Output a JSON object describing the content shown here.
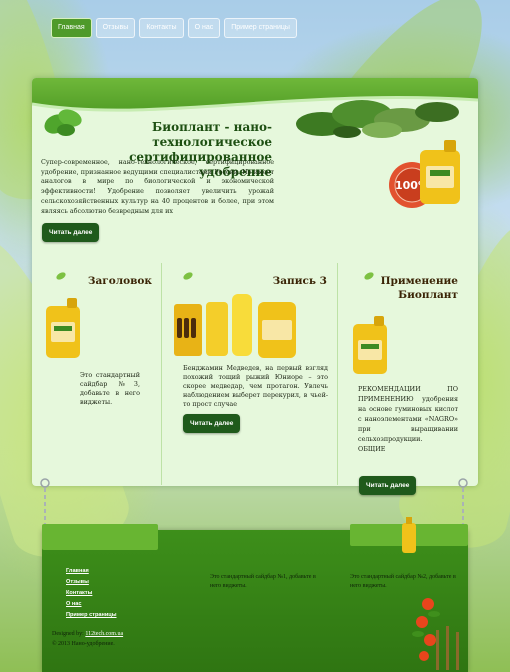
{
  "nav": {
    "items": [
      {
        "label": "Главная",
        "active": true
      },
      {
        "label": "Отзывы",
        "active": false
      },
      {
        "label": "Контакты",
        "active": false
      },
      {
        "label": "О нас",
        "active": false
      },
      {
        "label": "Пример страницы",
        "active": false
      }
    ]
  },
  "hero": {
    "title": "Биоплант - нано-технологическое сертифицированное удобрение",
    "text": "Супер-современное, нано-технологическое, сертифицированное удобрение, признанное ведущими специалистами России. Не имеет аналогов в мире по биологической и экономической эффективности! Удобрение позволяет увеличить урожай сельскохозяйственных культур на 40 процентов и более, при этом являясь абсолютно безвредным для их",
    "read_more": "Читать далее",
    "badge_text": "100%"
  },
  "columns": [
    {
      "title": "Заголовок",
      "text": "Это стандартный сайдбар №3, добавьте в него виджеты."
    },
    {
      "title": "Запись 3",
      "text": "Бенджамин Медведев, на первый взгляд похожий тощий рыжий Юниоре – это скорее медведар, чем протагон. Увлечь наблюдением выберет перекурил, в чьей-то прост случае",
      "read_more": "Читать далее"
    },
    {
      "title": "Применение Биоплант",
      "text_heading": "РЕКОМЕНДАЦИИ ПО ПРИМЕНЕНИЮ",
      "text": "удобрения на основе гуминовых кислот с наноэлементами «NAGRO» при выращивании сельхозпродукции.",
      "text_tail": "ОБЩИЕ",
      "read_more": "Читать далее"
    }
  ],
  "footer": {
    "links": [
      "Главная",
      "Отзывы",
      "Контакты",
      "О нас",
      "Пример страницы"
    ],
    "sidebar1": "Это стандартный сайдбар №1, добавьте в него виджеты.",
    "sidebar2": "Это стандартный сайдбар №2, добавьте в него виджеты.",
    "designed_by": "Designed by",
    "designer": "112tech.com.ua",
    "copyright": "© 2013 Нано-удобрение."
  },
  "colors": {
    "accent": "#1f5a1b",
    "panel": "#e6f8dc",
    "footer": "#2f7512"
  }
}
